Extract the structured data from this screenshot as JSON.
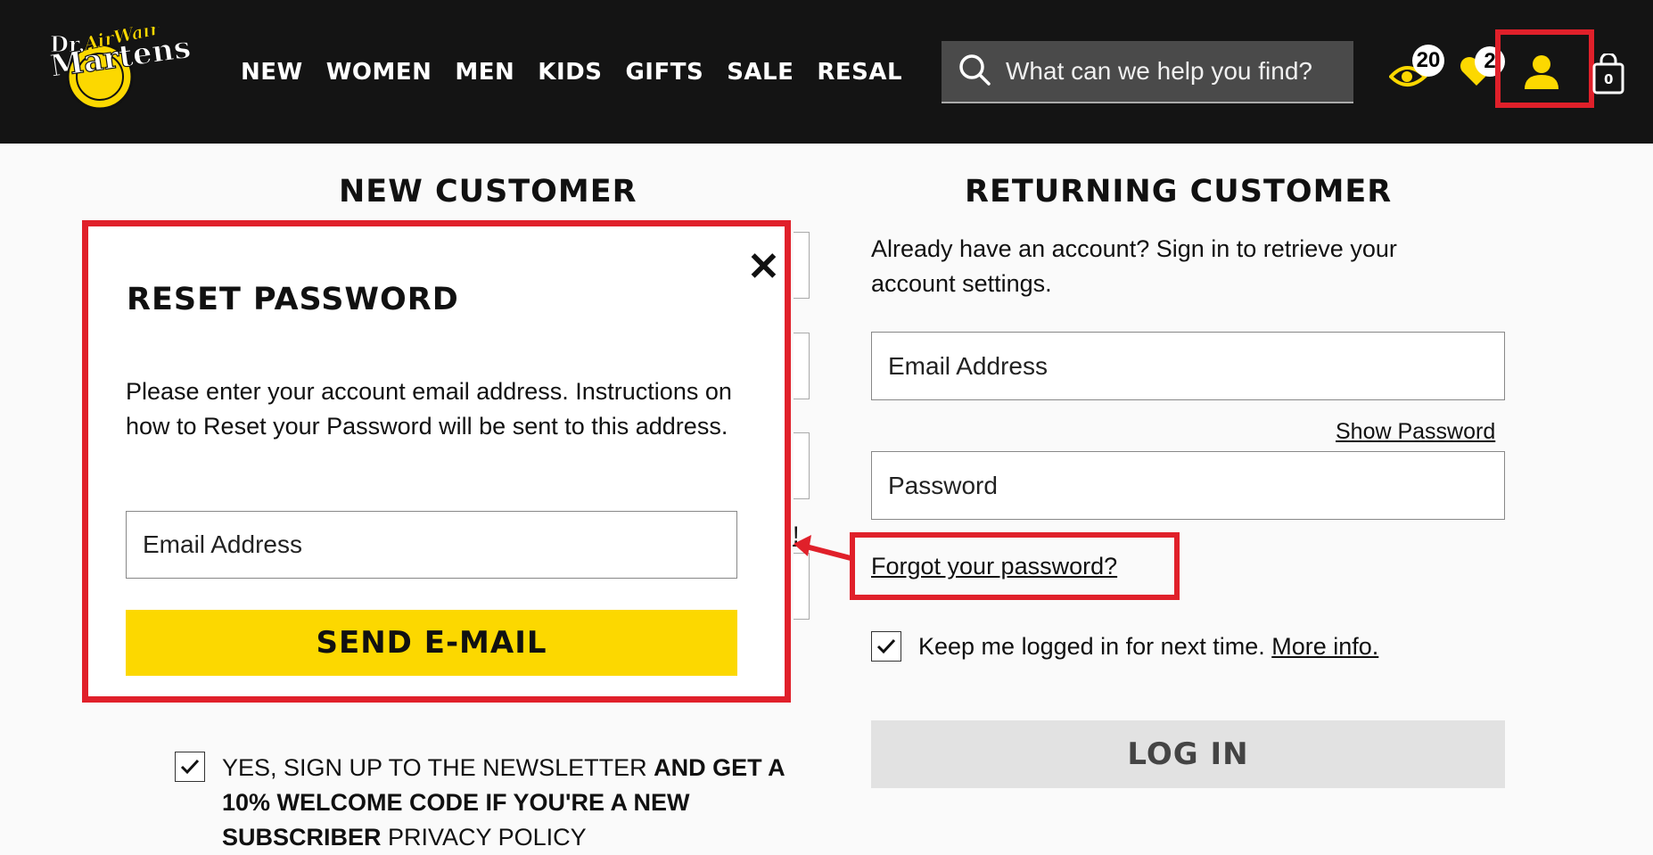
{
  "header": {
    "brand": "Dr. Martens AirWair Bouncing",
    "nav": [
      "NEW",
      "WOMEN",
      "MEN",
      "KIDS",
      "GIFTS",
      "SALE",
      "RESAL"
    ],
    "search_placeholder": "What can we help you find?",
    "recently_viewed_count": "20",
    "wishlist_count": "2",
    "icons": [
      "search-icon",
      "eye-icon",
      "heart-icon",
      "user-icon",
      "bag-icon"
    ],
    "accent_color": "#fcd800"
  },
  "new_customer": {
    "heading": "NEW CUSTOMER",
    "newsletter_normal": "YES, SIGN UP TO THE NEWSLETTER ",
    "newsletter_bold": "AND GET A 10% WELCOME CODE IF YOU'RE A NEW SUBSCRIBER",
    "newsletter_tail": " PRIVACY POLICY",
    "newsletter_checked": true,
    "partial_link": "!"
  },
  "returning_customer": {
    "heading": "RETURNING CUSTOMER",
    "intro": "Already have an account? Sign in to retrieve your account settings.",
    "email_placeholder": "Email Address",
    "show_password": "Show Password",
    "password_placeholder": "Password",
    "forgot_link": "Forgot your password?",
    "keep_logged_in": "Keep me logged in for next time.",
    "more_info": "More info.",
    "keep_checked": true,
    "login_button": "LOG IN"
  },
  "reset_modal": {
    "title": "RESET PASSWORD",
    "close": "✕",
    "description": "Please enter your account email address. Instructions on how to Reset your Password will be sent to this address.",
    "email_placeholder": "Email Address",
    "send_button": "SEND E-MAIL"
  },
  "annotation_color": "#e0202a"
}
